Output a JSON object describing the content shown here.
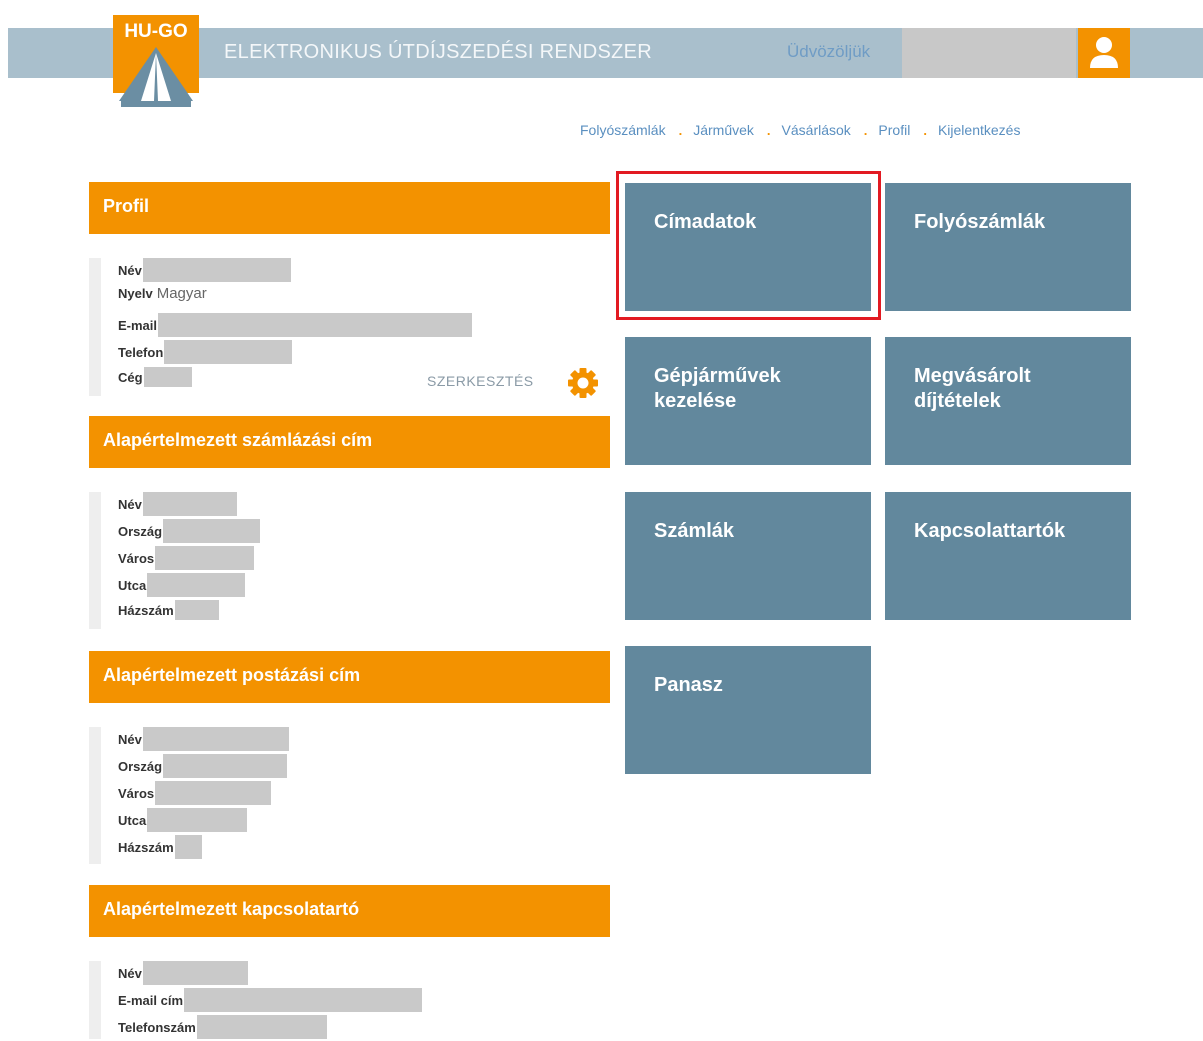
{
  "header": {
    "logo_text": "HU-GO",
    "system_title": "ELEKTRONIKUS ÚTDÍJSZEDÉSI RENDSZER",
    "welcome": "Üdvözöljük"
  },
  "nav": [
    "Folyószámlák",
    "Járművek",
    "Vásárlások",
    "Profil",
    "Kijelentkezés"
  ],
  "profile": {
    "title": "Profil",
    "fields": [
      {
        "label": "Név",
        "value": ""
      },
      {
        "label": "Nyelv",
        "value": "Magyar"
      },
      {
        "label": "E-mail",
        "value": ""
      },
      {
        "label": "Telefon",
        "value": ""
      },
      {
        "label": "Cég",
        "value": ""
      }
    ],
    "edit_label": "SZERKESZTÉS"
  },
  "billing": {
    "title": "Alapértelmezett számlázási cím",
    "fields": [
      "Név",
      "Ország",
      "Város",
      "Utca",
      "Házszám"
    ]
  },
  "postal": {
    "title": "Alapértelmezett postázási cím",
    "fields": [
      "Név",
      "Ország",
      "Város",
      "Utca",
      "Házszám"
    ]
  },
  "contact": {
    "title": "Alapértelmezett kapcsolatartó",
    "fields": [
      "Név",
      "E-mail cím",
      "Telefonszám"
    ]
  },
  "tiles": [
    {
      "label": "Címadatok",
      "selected": true
    },
    {
      "label": "Folyószámlák"
    },
    {
      "label": "Gépjárművek\nkezelése"
    },
    {
      "label": "Megvásárolt\ndíjtételek"
    },
    {
      "label": "Számlák"
    },
    {
      "label": "Kapcsolattartók"
    },
    {
      "label": "Panasz"
    }
  ],
  "colors": {
    "accent_orange": "#f39200",
    "tile_blue": "#62889d",
    "header_bar": "#a9bfcc",
    "highlight_red": "#e21a22",
    "link_blue": "#5a8fc0"
  },
  "icons": [
    "logo-road-icon",
    "user-icon",
    "gear-icon"
  ]
}
